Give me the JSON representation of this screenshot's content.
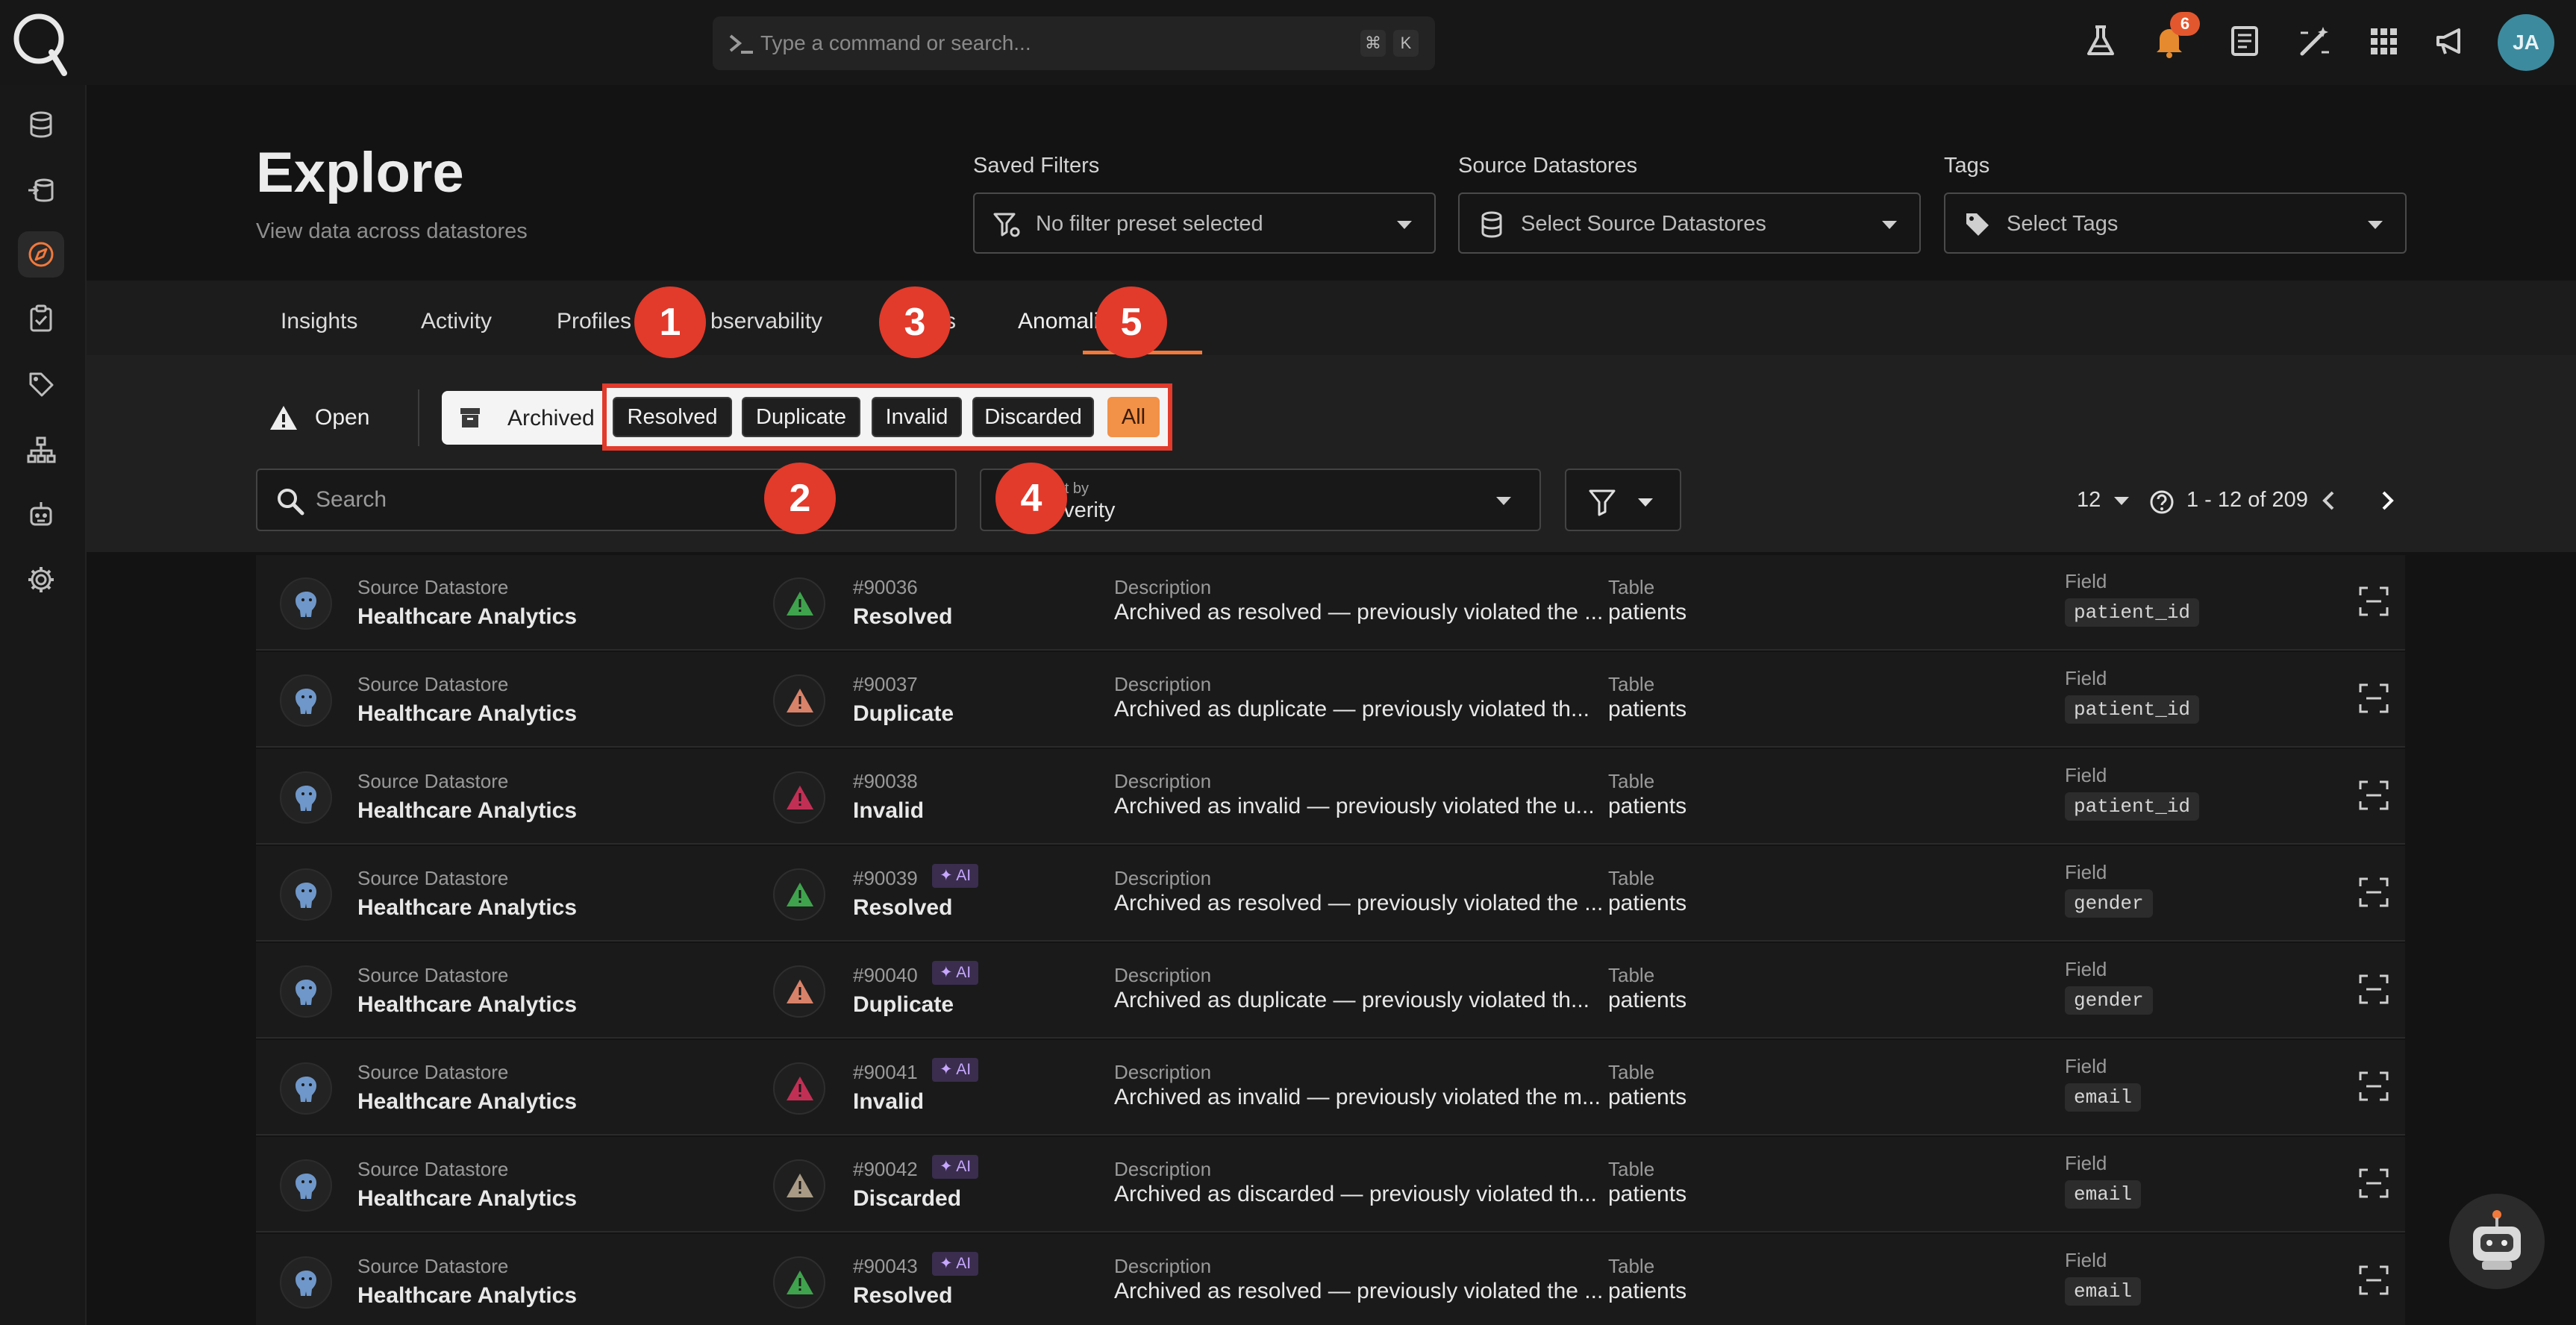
{
  "topbar": {
    "command_placeholder": "Type a command or search...",
    "kbd_cmd": "⌘",
    "kbd_k": "K",
    "notification_count": "6",
    "avatar_initials": "JA",
    "icons": [
      "flask-icon",
      "bell-icon",
      "document-icon",
      "magic-wand-icon",
      "grid-icon",
      "megaphone-icon"
    ]
  },
  "sidebar": {
    "items": [
      "database-icon",
      "datastore-sync-icon",
      "compass-icon",
      "checklist-icon",
      "tag-icon",
      "hierarchy-icon",
      "robot-icon",
      "gear-icon"
    ],
    "active": "compass-icon"
  },
  "header": {
    "title": "Explore",
    "subtitle": "View data across datastores",
    "saved_filters_label": "Saved Filters",
    "saved_filters_value": "No filter preset selected",
    "source_datastores_label": "Source Datastores",
    "source_datastores_value": "Select Source Datastores",
    "tags_label": "Tags",
    "tags_value": "Select Tags"
  },
  "tabs": [
    "Insights",
    "Activity",
    "Profiles",
    "Observability",
    "Checks",
    "Anomalies"
  ],
  "tabs_visible": [
    "Insights",
    "Activity",
    "Profiles",
    "bservability",
    "s",
    "Anomali"
  ],
  "active_tab": "Anomalies",
  "status": {
    "open_label": "Open",
    "archived_label": "Archived",
    "chips": [
      "Resolved",
      "Duplicate",
      "Invalid",
      "Discarded",
      "All"
    ],
    "selected_chip": "All"
  },
  "search": {
    "placeholder": "Search"
  },
  "sort": {
    "label": "Sort by",
    "label_visible": "ort by",
    "value": "Severity",
    "value_visible": "everity"
  },
  "pagination": {
    "page_size": "12",
    "range": "1 - 12 of 209"
  },
  "markers": [
    "1",
    "2",
    "3",
    "4",
    "5"
  ],
  "columns": {
    "source": "Source Datastore",
    "description": "Description",
    "table": "Table",
    "field": "Field"
  },
  "rows": [
    {
      "datastore": "Healthcare Analytics",
      "id": "#90036",
      "ai": false,
      "status": "Resolved",
      "severity_color": "#3fa34d",
      "description": "Archived as resolved — previously violated the ...",
      "table": "patients",
      "field": "patient_id"
    },
    {
      "datastore": "Healthcare Analytics",
      "id": "#90037",
      "ai": false,
      "status": "Duplicate",
      "severity_color": "#d9826a",
      "description": "Archived as duplicate — previously violated th...",
      "table": "patients",
      "field": "patient_id"
    },
    {
      "datastore": "Healthcare Analytics",
      "id": "#90038",
      "ai": false,
      "status": "Invalid",
      "severity_color": "#c22f55",
      "description": "Archived as invalid — previously violated the u...",
      "table": "patients",
      "field": "patient_id"
    },
    {
      "datastore": "Healthcare Analytics",
      "id": "#90039",
      "ai": true,
      "status": "Resolved",
      "severity_color": "#3fa34d",
      "description": "Archived as resolved — previously violated the ...",
      "table": "patients",
      "field": "gender"
    },
    {
      "datastore": "Healthcare Analytics",
      "id": "#90040",
      "ai": true,
      "status": "Duplicate",
      "severity_color": "#d9826a",
      "description": "Archived as duplicate — previously violated th...",
      "table": "patients",
      "field": "gender"
    },
    {
      "datastore": "Healthcare Analytics",
      "id": "#90041",
      "ai": true,
      "status": "Invalid",
      "severity_color": "#c22f55",
      "description": "Archived as invalid — previously violated the m...",
      "table": "patients",
      "field": "email"
    },
    {
      "datastore": "Healthcare Analytics",
      "id": "#90042",
      "ai": true,
      "status": "Discarded",
      "severity_color": "#a89a85",
      "description": "Archived as discarded — previously violated th...",
      "table": "patients",
      "field": "email"
    },
    {
      "datastore": "Healthcare Analytics",
      "id": "#90043",
      "ai": true,
      "status": "Resolved",
      "severity_color": "#3fa34d",
      "description": "Archived as resolved — previously violated the ...",
      "table": "patients",
      "field": "email"
    }
  ],
  "ai_badge": "AI",
  "colors": {
    "accent": "#f1793c",
    "marker": "#e23a2b",
    "selected_chip": "#f29148"
  }
}
